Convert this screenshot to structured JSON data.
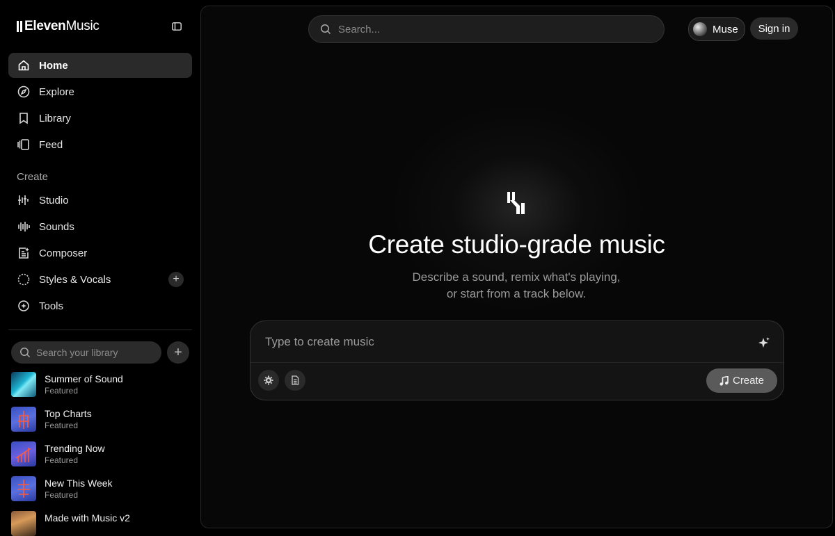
{
  "app": {
    "logo_bold": "Eleven",
    "logo_light": "Music"
  },
  "sidebar": {
    "nav": [
      {
        "label": "Home",
        "icon": "home-icon",
        "active": true
      },
      {
        "label": "Explore",
        "icon": "compass-icon"
      },
      {
        "label": "Library",
        "icon": "bookmark-icon"
      },
      {
        "label": "Feed",
        "icon": "feed-icon"
      }
    ],
    "create_label": "Create",
    "create_items": [
      {
        "label": "Studio",
        "icon": "studio-icon"
      },
      {
        "label": "Sounds",
        "icon": "waveform-icon"
      },
      {
        "label": "Composer",
        "icon": "composer-icon"
      },
      {
        "label": "Styles & Vocals",
        "icon": "dotted-circle-icon"
      },
      {
        "label": "Tools",
        "icon": "tools-icon"
      }
    ],
    "library_search_placeholder": "Search your library",
    "library": [
      {
        "title": "Summer of Sound",
        "subtitle": "Featured"
      },
      {
        "title": "Top Charts",
        "subtitle": "Featured"
      },
      {
        "title": "Trending Now",
        "subtitle": "Featured"
      },
      {
        "title": "New This Week",
        "subtitle": "Featured"
      },
      {
        "title": "Made with Music v2",
        "subtitle": ""
      }
    ]
  },
  "header": {
    "search_placeholder": "Search...",
    "muse_label": "Muse",
    "signin_label": "Sign in"
  },
  "hero": {
    "title": "Create studio-grade music",
    "subtitle": "Describe a sound, remix what's playing, or start from a track below."
  },
  "composer": {
    "placeholder": "Type to create music",
    "create_label": "Create"
  },
  "colors": {
    "background": "#000000",
    "panel": "#070707",
    "active_nav": "#2a2a2a",
    "create_button": "#5a5a5a"
  }
}
